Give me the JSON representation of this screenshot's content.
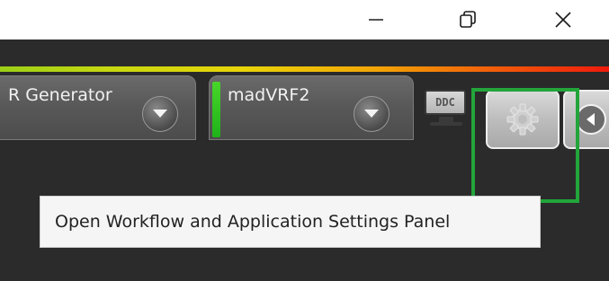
{
  "window": {
    "minimize_icon": "minimize-icon",
    "restore_icon": "restore-icon",
    "close_icon": "close-icon"
  },
  "level_bar": {
    "colors": [
      "#9bcf17",
      "#e8d409",
      "#f3a407",
      "#ee1b0c"
    ]
  },
  "tabs": [
    {
      "label": "R Generator",
      "dropdown_icon": "chevron-down-icon"
    },
    {
      "label": "madVRF2",
      "dropdown_icon": "chevron-down-icon",
      "status_color": "#2ec524"
    }
  ],
  "toolbar": {
    "ddc_label": "DDC",
    "settings_icon": "gear-icon",
    "nav_icon": "chevron-left-icon"
  },
  "highlight": {
    "color": "#22a53a"
  },
  "tooltip": {
    "text": "Open Workflow and Application Settings Panel"
  }
}
